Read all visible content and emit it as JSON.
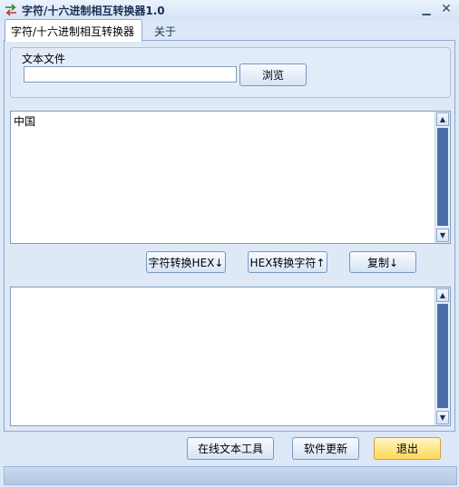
{
  "window": {
    "title": "字符/十六进制相互转换器1.0",
    "minimize_glyph": "▁",
    "close_glyph": "✕"
  },
  "tabs": [
    {
      "label": "字符/十六进制相互转换器",
      "active": true
    },
    {
      "label": "关于",
      "active": false
    }
  ],
  "file": {
    "label": "文本文件",
    "value": "",
    "browse_label": "浏览"
  },
  "input_text": "中国",
  "output_text": "",
  "actions": {
    "to_hex_label": "字符转换HEX↓",
    "to_char_label": "HEX转换字符↑",
    "copy_label": "复制↓"
  },
  "footer": {
    "online_tools_label": "在线文本工具",
    "update_label": "软件更新",
    "exit_label": "退出"
  },
  "icons": {
    "app": "swap-arrows-icon",
    "scroll_up": "▲",
    "scroll_down": "▼"
  },
  "colors": {
    "window_bg": "#dce8f7",
    "accent_blue": "#4c6ea8",
    "exit_button": "#ffd75a"
  }
}
